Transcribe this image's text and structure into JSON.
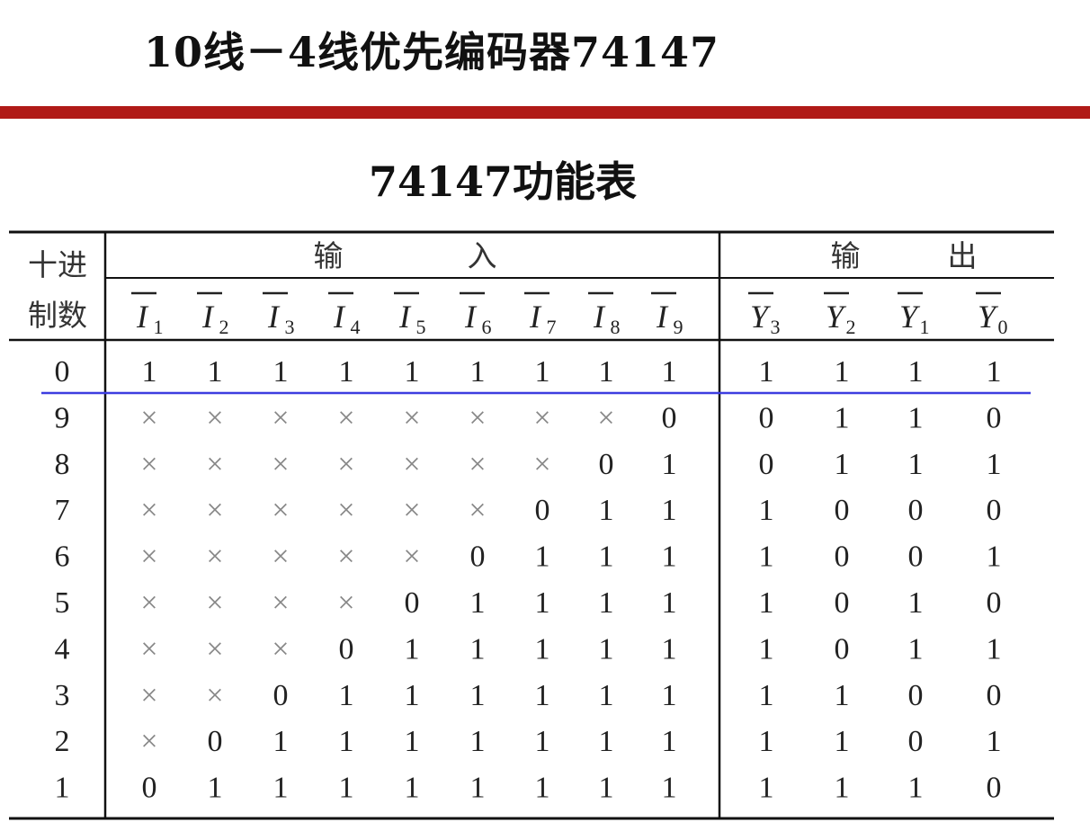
{
  "page_title": "10线－4线优先编码器74147",
  "table_title": "74147功能表",
  "headers": {
    "decimal_line1": "十进",
    "decimal_line2": "制数",
    "inputs": [
      "输",
      "入"
    ],
    "outputs": [
      "输",
      "出"
    ]
  },
  "input_symbols": [
    {
      "main": "I",
      "sub": "1"
    },
    {
      "main": "I",
      "sub": "2"
    },
    {
      "main": "I",
      "sub": "3"
    },
    {
      "main": "I",
      "sub": "4"
    },
    {
      "main": "I",
      "sub": "5"
    },
    {
      "main": "I",
      "sub": "6"
    },
    {
      "main": "I",
      "sub": "7"
    },
    {
      "main": "I",
      "sub": "8"
    },
    {
      "main": "I",
      "sub": "9"
    }
  ],
  "output_symbols": [
    {
      "main": "Y",
      "sub": "3"
    },
    {
      "main": "Y",
      "sub": "2"
    },
    {
      "main": "Y",
      "sub": "1"
    },
    {
      "main": "Y",
      "sub": "0"
    }
  ],
  "rows": [
    {
      "decimal": "0",
      "inputs": [
        "1",
        "1",
        "1",
        "1",
        "1",
        "1",
        "1",
        "1",
        "1"
      ],
      "outputs": [
        "1",
        "1",
        "1",
        "1"
      ]
    },
    {
      "decimal": "9",
      "inputs": [
        "×",
        "×",
        "×",
        "×",
        "×",
        "×",
        "×",
        "×",
        "0"
      ],
      "outputs": [
        "0",
        "1",
        "1",
        "0"
      ]
    },
    {
      "decimal": "8",
      "inputs": [
        "×",
        "×",
        "×",
        "×",
        "×",
        "×",
        "×",
        "0",
        "1"
      ],
      "outputs": [
        "0",
        "1",
        "1",
        "1"
      ]
    },
    {
      "decimal": "7",
      "inputs": [
        "×",
        "×",
        "×",
        "×",
        "×",
        "×",
        "0",
        "1",
        "1"
      ],
      "outputs": [
        "1",
        "0",
        "0",
        "0"
      ]
    },
    {
      "decimal": "6",
      "inputs": [
        "×",
        "×",
        "×",
        "×",
        "×",
        "0",
        "1",
        "1",
        "1"
      ],
      "outputs": [
        "1",
        "0",
        "0",
        "1"
      ]
    },
    {
      "decimal": "5",
      "inputs": [
        "×",
        "×",
        "×",
        "×",
        "0",
        "1",
        "1",
        "1",
        "1"
      ],
      "outputs": [
        "1",
        "0",
        "1",
        "0"
      ]
    },
    {
      "decimal": "4",
      "inputs": [
        "×",
        "×",
        "×",
        "0",
        "1",
        "1",
        "1",
        "1",
        "1"
      ],
      "outputs": [
        "1",
        "0",
        "1",
        "1"
      ]
    },
    {
      "decimal": "3",
      "inputs": [
        "×",
        "×",
        "0",
        "1",
        "1",
        "1",
        "1",
        "1",
        "1"
      ],
      "outputs": [
        "1",
        "1",
        "0",
        "0"
      ]
    },
    {
      "decimal": "2",
      "inputs": [
        "×",
        "0",
        "1",
        "1",
        "1",
        "1",
        "1",
        "1",
        "1"
      ],
      "outputs": [
        "1",
        "1",
        "0",
        "1"
      ]
    },
    {
      "decimal": "1",
      "inputs": [
        "0",
        "1",
        "1",
        "1",
        "1",
        "1",
        "1",
        "1",
        "1"
      ],
      "outputs": [
        "1",
        "1",
        "1",
        "0"
      ]
    }
  ],
  "colors": {
    "accent_bar": "#b01a17",
    "highlight_line": "#3d3de0",
    "rule": "#111111",
    "cross": "#888888"
  }
}
